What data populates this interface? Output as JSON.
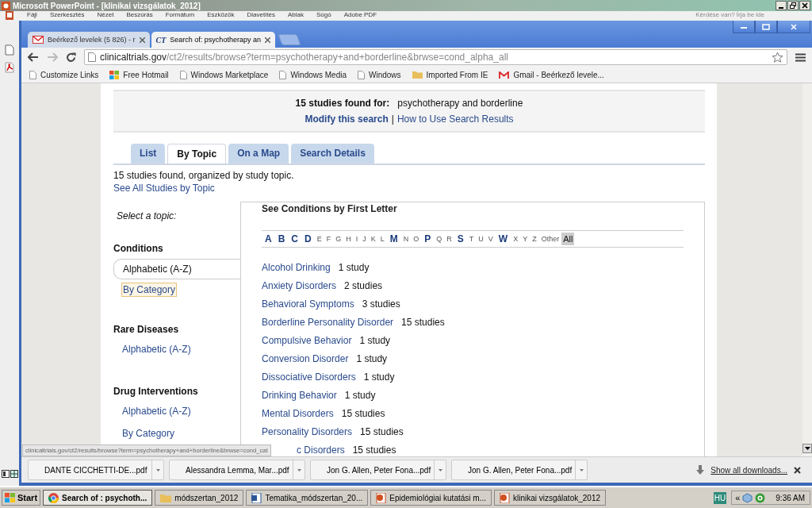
{
  "ppt_window": {
    "title": "Microsoft PowerPoint - [klinikai vizsgálatok_2012]",
    "menu": [
      "Fájl",
      "Szerkesztés",
      "Nézet",
      "Beszúrás",
      "Formátum",
      "Eszközök",
      "Diavetítés",
      "Ablak",
      "Súgó",
      "Adobe PDF"
    ],
    "help_box": "Kérdése van? Írja be ide"
  },
  "browser": {
    "tabs": [
      {
        "kind": "gmail",
        "title": "Beérkező levelek (5 826) - r",
        "selected": false
      },
      {
        "kind": "ct",
        "icon_text": "CT",
        "title": "Search of: psychotherapy an",
        "selected": true
      }
    ],
    "url_host": "clinicaltrials.gov",
    "url_path": "/ct2/results/browse?term=psychotherapy+and+borderline&brwse=cond_alpha_all",
    "bookmarks": [
      {
        "kind": "page",
        "label": "Customize Links"
      },
      {
        "kind": "windows",
        "label": "Free Hotmail"
      },
      {
        "kind": "page",
        "label": "Windows Marketplace"
      },
      {
        "kind": "page",
        "label": "Windows Media"
      },
      {
        "kind": "page",
        "label": "Windows"
      },
      {
        "kind": "folder",
        "label": "Imported From IE"
      },
      {
        "kind": "gmail",
        "label": "Gmail - Beérkező levele..."
      }
    ],
    "status_url": "clinicaltrials.gov/ct2/results/browse?term=psychotherapy+and+borderline&brwse=cond_cat",
    "downloads": [
      "DANTE CICCHETTI-DE...pdf",
      "Alessandra Lemma, Mar...pdf",
      "Jon G. Allen, Peter Fona...pdf",
      "Jon G. Allen, Peter Fona...pdf"
    ],
    "show_all": "Show all downloads..."
  },
  "page": {
    "found_label": "15 studies found for:",
    "query": "psychotherapy and borderline",
    "modify": "Modify this search",
    "separator": "|",
    "how_to": "How to Use Search Results",
    "tabs": [
      {
        "label": "List",
        "selected": false
      },
      {
        "label": "By Topic",
        "selected": true
      },
      {
        "label": "On a Map",
        "selected": false
      },
      {
        "label": "Search Details",
        "selected": false
      }
    ],
    "summary": "15 studies found, organized by study topic.",
    "see_all": "See All Studies by Topic",
    "select_label": "Select a topic:",
    "sections": [
      {
        "title": "Conditions",
        "links": [
          {
            "label": "Alphabetic (A-Z)",
            "selected": true,
            "focused": false
          },
          {
            "label": "By Category",
            "selected": false,
            "focused": true
          }
        ]
      },
      {
        "title": "Rare Diseases",
        "links": [
          {
            "label": "Alphabetic (A-Z)",
            "selected": false,
            "focused": false
          }
        ]
      },
      {
        "title": "Drug Interventions",
        "links": [
          {
            "label": "Alphabetic (A-Z)",
            "selected": false,
            "focused": false
          },
          {
            "label": "By Category",
            "selected": false,
            "focused": false
          }
        ]
      }
    ],
    "panel_title": "See Conditions by First Letter",
    "letters": [
      {
        "label": "A",
        "has_studies": true,
        "selected": false
      },
      {
        "label": "B",
        "has_studies": true,
        "selected": false
      },
      {
        "label": "C",
        "has_studies": true,
        "selected": false
      },
      {
        "label": "D",
        "has_studies": true,
        "selected": false
      },
      {
        "label": "E",
        "has_studies": false,
        "selected": false
      },
      {
        "label": "F",
        "has_studies": false,
        "selected": false
      },
      {
        "label": "G",
        "has_studies": false,
        "selected": false
      },
      {
        "label": "H",
        "has_studies": false,
        "selected": false
      },
      {
        "label": "I",
        "has_studies": false,
        "selected": false
      },
      {
        "label": "J",
        "has_studies": false,
        "selected": false
      },
      {
        "label": "K",
        "has_studies": false,
        "selected": false
      },
      {
        "label": "L",
        "has_studies": false,
        "selected": false
      },
      {
        "label": "M",
        "has_studies": true,
        "selected": false
      },
      {
        "label": "N",
        "has_studies": false,
        "selected": false
      },
      {
        "label": "O",
        "has_studies": false,
        "selected": false
      },
      {
        "label": "P",
        "has_studies": true,
        "selected": false
      },
      {
        "label": "Q",
        "has_studies": false,
        "selected": false
      },
      {
        "label": "R",
        "has_studies": false,
        "selected": false
      },
      {
        "label": "S",
        "has_studies": true,
        "selected": false
      },
      {
        "label": "T",
        "has_studies": false,
        "selected": false
      },
      {
        "label": "U",
        "has_studies": false,
        "selected": false
      },
      {
        "label": "V",
        "has_studies": false,
        "selected": false
      },
      {
        "label": "W",
        "has_studies": true,
        "selected": false
      },
      {
        "label": "X",
        "has_studies": false,
        "selected": false
      },
      {
        "label": "Y",
        "has_studies": false,
        "selected": false
      },
      {
        "label": "Z",
        "has_studies": false,
        "selected": false
      },
      {
        "label": "Other",
        "has_studies": false,
        "selected": false
      },
      {
        "label": "All",
        "has_studies": false,
        "selected": true
      }
    ],
    "conditions": [
      {
        "name": "Alcohol Drinking",
        "count": "1 study"
      },
      {
        "name": "Anxiety Disorders",
        "count": "2 studies"
      },
      {
        "name": "Behavioral Symptoms",
        "count": "3 studies"
      },
      {
        "name": "Borderline Personality Disorder",
        "count": "15 studies"
      },
      {
        "name": "Compulsive Behavior",
        "count": "1 study"
      },
      {
        "name": "Conversion Disorder",
        "count": "1 study"
      },
      {
        "name": "Dissociative Disorders",
        "count": "1 study"
      },
      {
        "name": "Drinking Behavior",
        "count": "1 study"
      },
      {
        "name": "Mental Disorders",
        "count": "15 studies"
      },
      {
        "name": "Personality Disorders",
        "count": "15 studies"
      },
      {
        "name": "c Disorders",
        "count": "15 studies"
      }
    ]
  },
  "taskbar": {
    "start": "Start",
    "items": [
      {
        "kind": "chrome",
        "label": "Search of : psychoth...",
        "selected": true
      },
      {
        "kind": "folder",
        "label": "módszertan_2012",
        "selected": false
      },
      {
        "kind": "word",
        "label": "Tematika_módszertan_20...",
        "selected": false
      },
      {
        "kind": "ppt",
        "label": "Epidemiológiai kutatási m...",
        "selected": false
      },
      {
        "kind": "ppt",
        "label": "klinikai vizsgálatok_2012",
        "selected": false
      }
    ],
    "language": "HU",
    "expand": "«",
    "clock": "9:36 AM"
  }
}
